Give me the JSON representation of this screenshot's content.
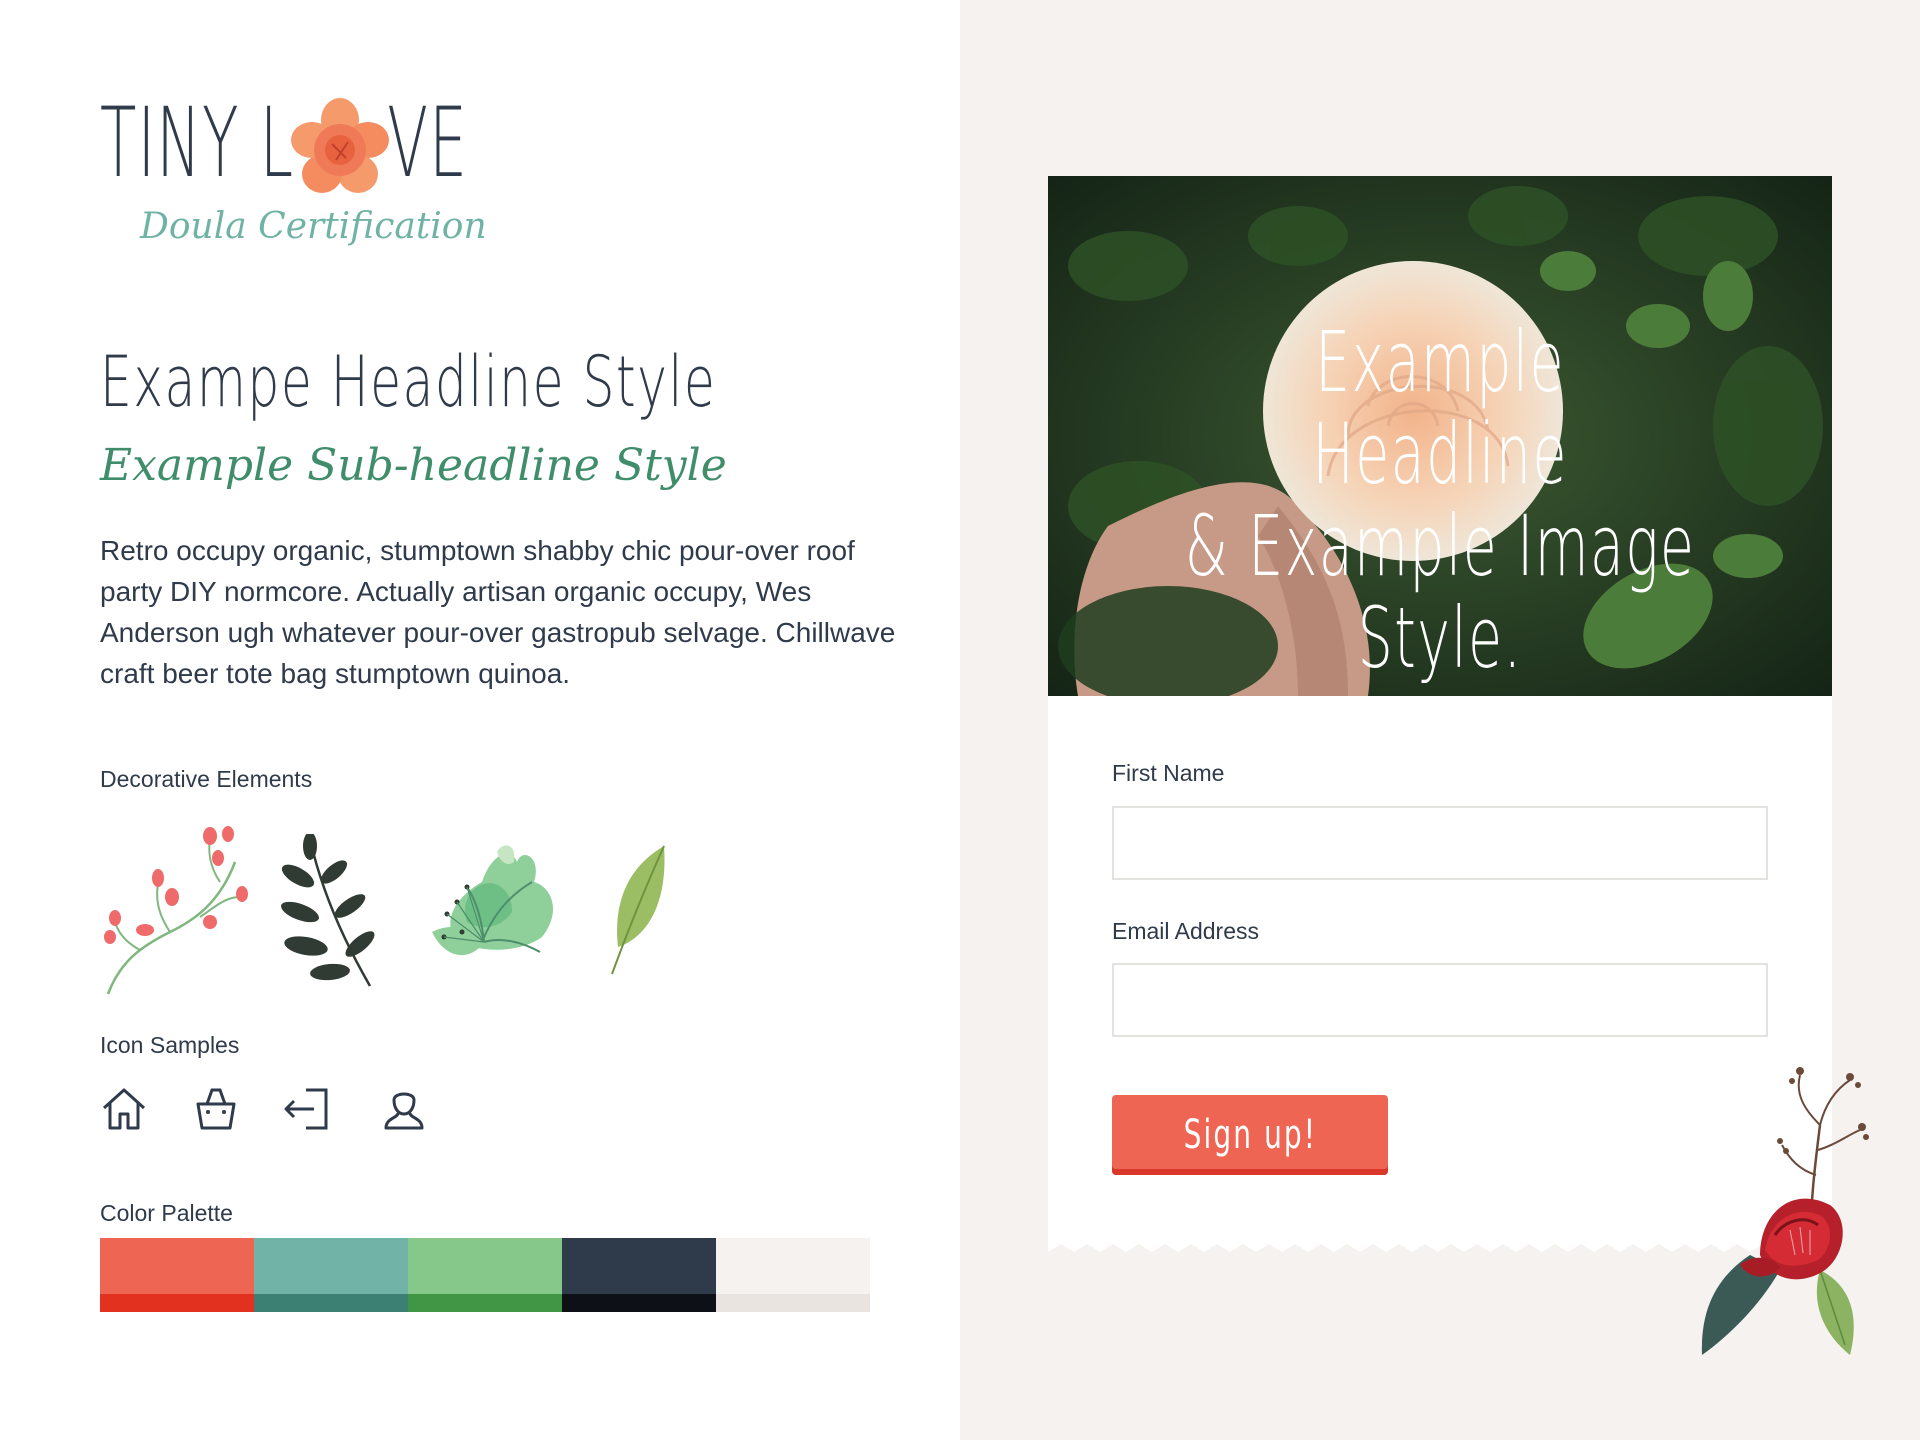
{
  "brand": {
    "name_left": "TINY L",
    "name_right": "VE",
    "tagline": "Doula Certification"
  },
  "typography": {
    "headline": "Exampe Headline Style",
    "subheadline": "Example Sub-headline Style",
    "body": "Retro occupy organic, stumptown shabby chic pour-over roof party DIY normcore. Actually artisan organic occupy, Wes Anderson ugh whatever pour-over gastropub selvage. Chillwave craft beer tote bag stumptown quinoa."
  },
  "sections": {
    "decorative": "Decorative Elements",
    "icons": "Icon Samples",
    "palette": "Color Palette"
  },
  "icons": [
    "home-icon",
    "shopping-bag-icon",
    "login-icon",
    "user-icon"
  ],
  "palette": [
    {
      "top": "#ef6553",
      "bottom": "#e2311f"
    },
    {
      "top": "#71b3a7",
      "bottom": "#3b8073"
    },
    {
      "top": "#86c78a",
      "bottom": "#419646"
    },
    {
      "top": "#2f3a4b",
      "bottom": "#0d1117"
    },
    {
      "top": "#f5f2ef",
      "bottom": "#e9e4df"
    }
  ],
  "hero": {
    "line1": "Example Headline",
    "line2": "& Example Image",
    "line3": "Style."
  },
  "form": {
    "first_name_label": "First Name",
    "first_name_value": "",
    "email_label": "Email Address",
    "email_value": "",
    "submit_label": "Sign up!"
  }
}
